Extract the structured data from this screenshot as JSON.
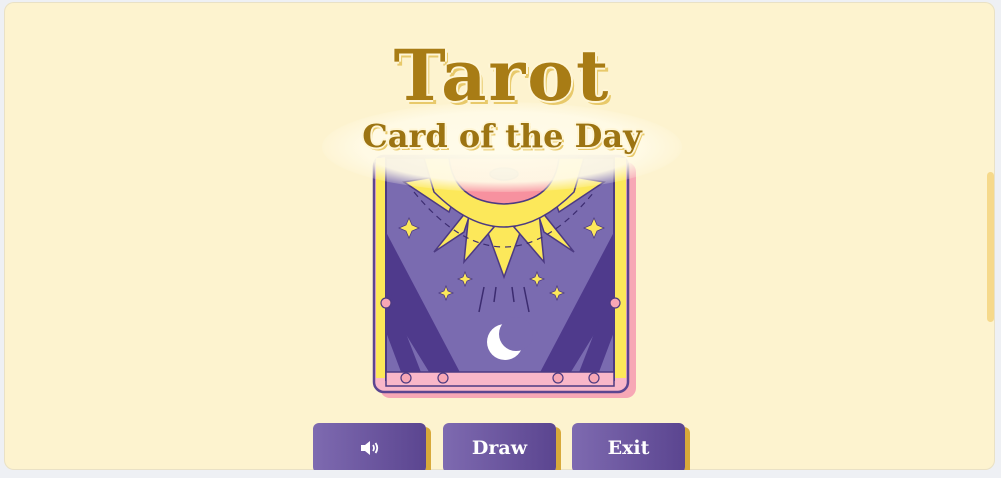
{
  "title": {
    "main": "Tarot",
    "subtitle": "Card of the Day"
  },
  "buttons": {
    "sound_icon": "speaker-volume-icon",
    "draw_label": "Draw",
    "exit_label": "Exit"
  },
  "colors": {
    "background": "#fdf3cf",
    "title_gold": "#a87c15",
    "button_purple": "#6b56a0",
    "button_shadow": "#d8a93a",
    "card_purple": "#7a6bb0",
    "card_pink": "#f7a7b5",
    "card_yellow": "#fce85a"
  }
}
